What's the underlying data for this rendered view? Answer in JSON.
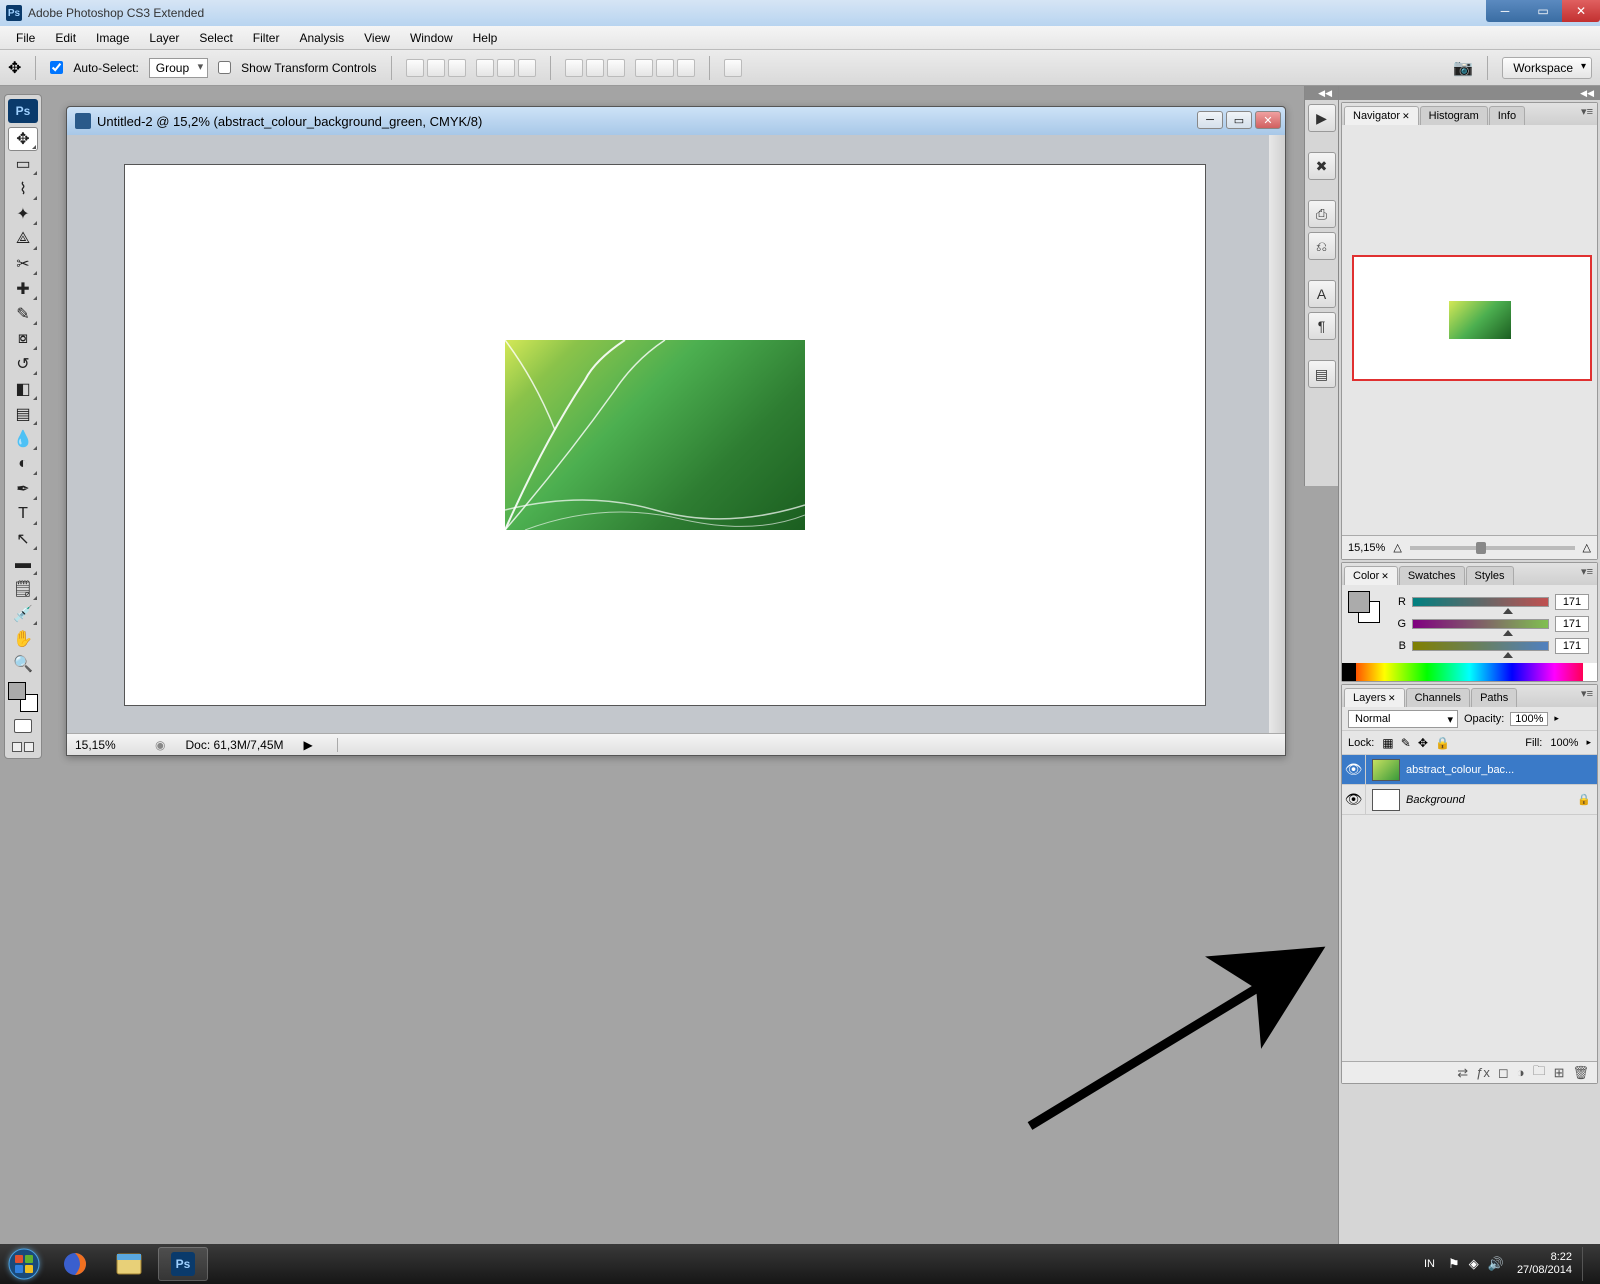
{
  "titlebar": {
    "app_title": "Adobe Photoshop CS3 Extended"
  },
  "menu": {
    "items": [
      "File",
      "Edit",
      "Image",
      "Layer",
      "Select",
      "Filter",
      "Analysis",
      "View",
      "Window",
      "Help"
    ]
  },
  "options": {
    "auto_select_label": "Auto-Select:",
    "auto_select_value": "Group",
    "show_transform_label": "Show Transform Controls",
    "workspace_label": "Workspace"
  },
  "document": {
    "title": "Untitled-2 @ 15,2% (abstract_colour_background_green, CMYK/8)",
    "zoom": "15,15%",
    "doc_info": "Doc: 61,3M/7,45M"
  },
  "navigator": {
    "tabs": [
      "Navigator",
      "Histogram",
      "Info"
    ],
    "zoom": "15,15%"
  },
  "color": {
    "tabs": [
      "Color",
      "Swatches",
      "Styles"
    ],
    "r_label": "R",
    "g_label": "G",
    "b_label": "B",
    "r_value": "171",
    "g_value": "171",
    "b_value": "171"
  },
  "layers": {
    "tabs": [
      "Layers",
      "Channels",
      "Paths"
    ],
    "blend_mode": "Normal",
    "opacity_label": "Opacity:",
    "opacity_value": "100%",
    "lock_label": "Lock:",
    "fill_label": "Fill:",
    "fill_value": "100%",
    "items": [
      {
        "name": "abstract_colour_bac...",
        "selected": true
      },
      {
        "name": "Background",
        "locked": true
      }
    ]
  },
  "taskbar": {
    "lang": "IN",
    "time": "8:22",
    "date": "27/08/2014"
  }
}
